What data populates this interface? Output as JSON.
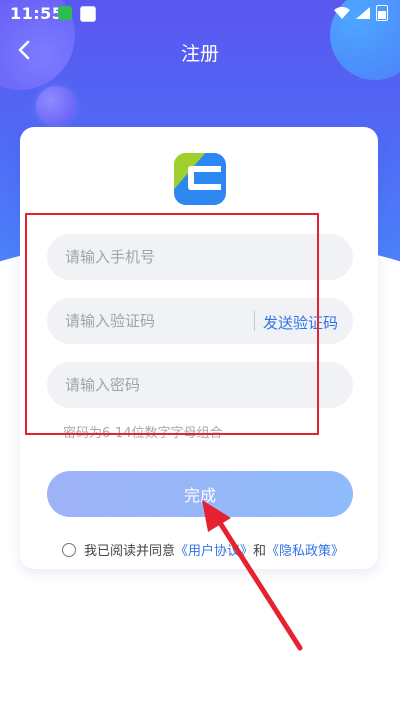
{
  "status": {
    "time": "11:55"
  },
  "nav": {
    "title": "注册",
    "back_icon": "chevron-left-icon"
  },
  "form": {
    "phone_placeholder": "请输入手机号",
    "code_placeholder": "请输入验证码",
    "send_code_label": "发送验证码",
    "password_placeholder": "请输入密码",
    "password_hint": "密码为6-14位数字字母组合"
  },
  "submit": {
    "label": "完成"
  },
  "agreement": {
    "prefix": "我已阅读并同意",
    "user_agreement": "《用户协议》",
    "conjunction": "和",
    "privacy_policy": "《隐私政策》"
  },
  "colors": {
    "primary": "#2f74e6",
    "highlight_box": "#e42231",
    "annotation_arrow": "#e42231"
  }
}
